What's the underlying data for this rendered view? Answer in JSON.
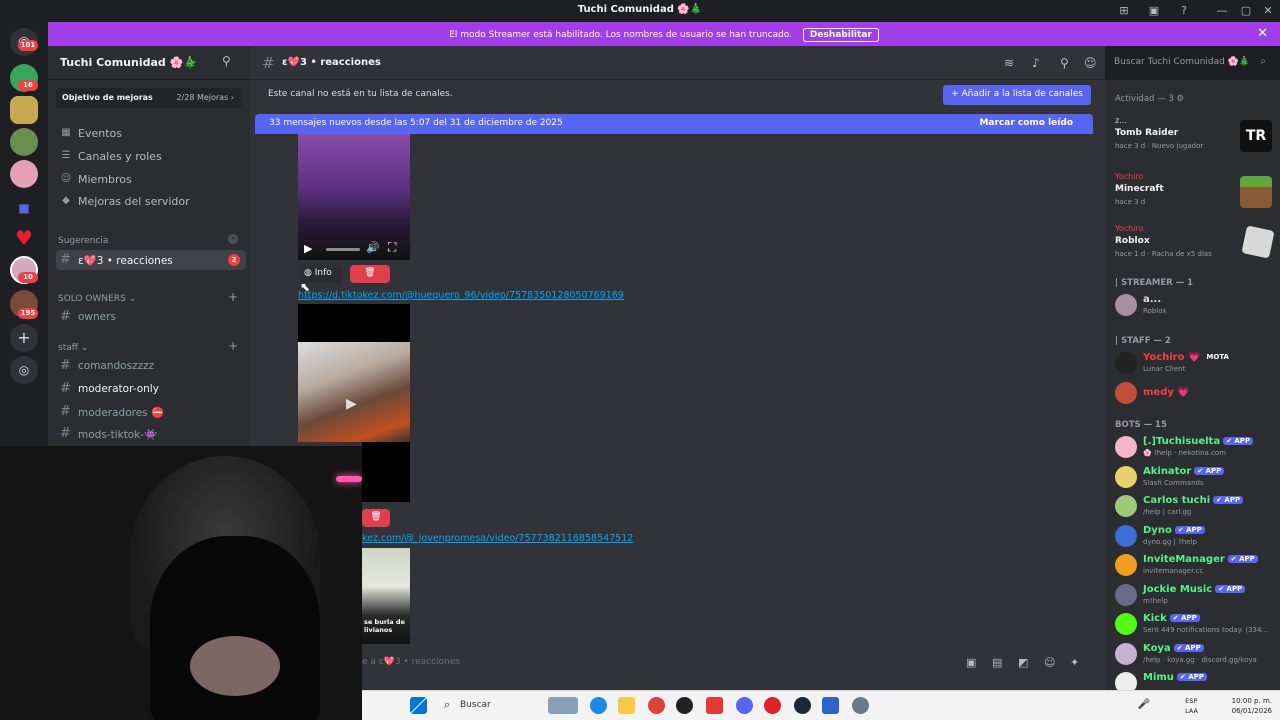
{
  "window": {
    "title": "Tuchi Comunidad 🌸🎄",
    "controls": [
      "—",
      "▢",
      "✕"
    ]
  },
  "banner": {
    "text": "El modo Streamer está habilitado. Los nombres de usuario se han truncado.",
    "button": "Deshabilitar"
  },
  "rail": {
    "badges": [
      "101",
      "16",
      "10",
      "195"
    ]
  },
  "server": {
    "name": "Tuchi Comunidad 🌸🎄",
    "boost": {
      "label": "Objetivo de mejoras",
      "progress": "2/28 Mejoras ›"
    },
    "nav": [
      "Eventos",
      "Canales y roles",
      "Miembros",
      "Mejoras del servidor"
    ],
    "categories": {
      "sugerencia": "Sugerencia",
      "solo_owners": "SOLO OWNERS ⌄",
      "staff": "staff ⌄"
    },
    "channels": {
      "reacciones": "ε💖3 • reacciones",
      "reacciones_badge": "2",
      "owners": "owners",
      "comandos": "comandoszzzz",
      "moderator_only": "moderator-only",
      "moderadores": "moderadores ⛔",
      "mods_tiktok": "mods-tiktok-👾"
    }
  },
  "channel_header": {
    "name": "ε💖3 • reacciones",
    "search_placeholder": "Buscar Tuchi Comunidad 🌸🎄"
  },
  "chat": {
    "notice": "Este canal no está en tu lista de canales.",
    "add_button": "+ Añadir a la lista de canales",
    "new_messages": "33 mensajes nuevos desde las 5:07 del 31 de diciembre de 2025",
    "mark_read": "Marcar como leído",
    "info_label": "Info",
    "link1": "https://d.tiktokez.com/@huequero_96/video/7578350128050769169",
    "link2": "kez.com/@_jovenpromesa/video/7577382116858547512",
    "video_caption": "se burla de livianos",
    "composer_placeholder": "e a ε💖3 • reacciones"
  },
  "members": {
    "activity_header": "Actividad — 3 ⚙",
    "activities": [
      {
        "user": "z...",
        "game": "Tomb Raider",
        "sub": "hace 3 d · Nuevo jugador",
        "art_text": "TR"
      },
      {
        "user": "Yochiro",
        "game": "Minecraft",
        "sub": "hace 3 d"
      },
      {
        "user": "Yochiro",
        "game": "Roblox",
        "sub": "hace 1 d · Racha de x5 días"
      }
    ],
    "groups": [
      {
        "header": "| STREAMER — 1",
        "items": [
          {
            "name": "a...",
            "status": "Roblox",
            "color": "#dbdee1"
          }
        ]
      },
      {
        "header": "| STAFF — 2",
        "items": [
          {
            "name": "Yochiro 💗",
            "status": "Lunar Client",
            "color": "#f23f43",
            "tag": "MOTA"
          },
          {
            "name": "medy 💗",
            "status": "",
            "color": "#f23f43"
          }
        ]
      },
      {
        "header": "BOTS — 15",
        "items": [
          {
            "name": "[.]Tuchisuelta",
            "status": "🌸 !help · nekotina.com",
            "color": "#57f287",
            "tag": "✔ APP"
          },
          {
            "name": "Akinator",
            "status": "Slash Commands",
            "color": "#57f287",
            "tag": "✔ APP"
          },
          {
            "name": "Carlos tuchi",
            "status": "/help | carl.gg",
            "color": "#57f287",
            "tag": "✔ APP"
          },
          {
            "name": "Dyno",
            "status": "dyno.gg | ?help",
            "color": "#57f287",
            "tag": "✔ APP"
          },
          {
            "name": "InviteManager",
            "status": "invitemanager.cc",
            "color": "#57f287",
            "tag": "✔ APP"
          },
          {
            "name": "Jockie Music",
            "status": "m!help",
            "color": "#57f287",
            "tag": "✔ APP"
          },
          {
            "name": "Kick",
            "status": "Sent 449 notifications today. (334...",
            "color": "#57f287",
            "tag": "✔ APP"
          },
          {
            "name": "Koya",
            "status": "/help · koya.gg · discord.gg/koya",
            "color": "#57f287",
            "tag": "✔ APP"
          },
          {
            "name": "Mimu",
            "status": "",
            "color": "#57f287",
            "tag": "✔ APP"
          }
        ]
      }
    ]
  },
  "taskbar": {
    "search": "Buscar",
    "lang": "ESP\nLAA",
    "time": "10:00 p. m.",
    "date": "06/01/2026"
  },
  "colors": {
    "accent": "#5865f2",
    "banner": "#a23ee8",
    "danger": "#f23f43",
    "bot_green": "#57f287"
  }
}
